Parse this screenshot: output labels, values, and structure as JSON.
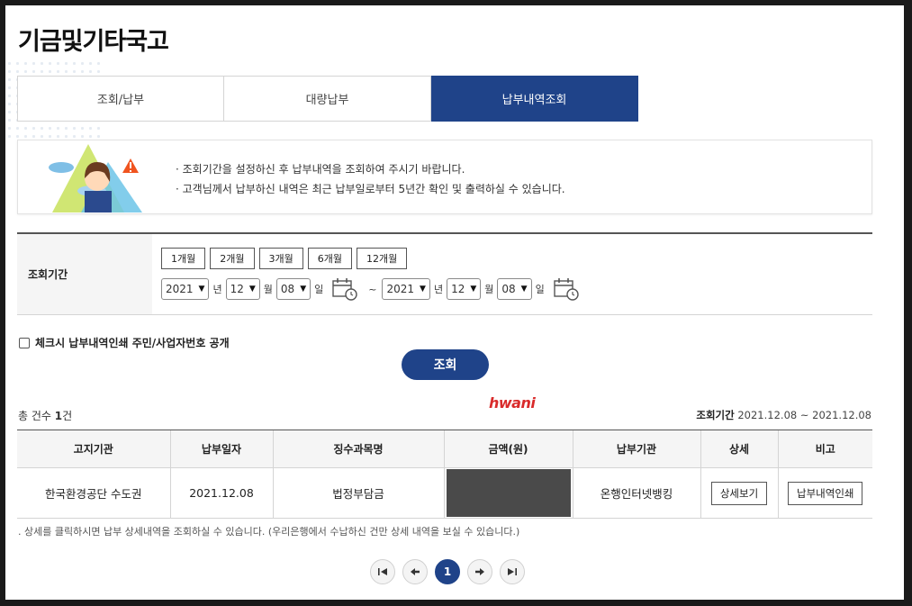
{
  "page": {
    "title": "기금및기타국고"
  },
  "tabs": [
    {
      "label": "조회/납부",
      "active": false
    },
    {
      "label": "대량납부",
      "active": false
    },
    {
      "label": "납부내역조회",
      "active": true
    }
  ],
  "notice": {
    "lines": [
      "조회기간을 설정하신 후 납부내역을 조회하여 주시기 바랍니다.",
      "고객님께서 납부하신 내역은 최근 납부일로부터 5년간 확인 및 출력하실 수 있습니다."
    ]
  },
  "search": {
    "label": "조회기간",
    "months": [
      "1개월",
      "2개월",
      "3개월",
      "6개월",
      "12개월"
    ],
    "from": {
      "year": "2021",
      "month": "12",
      "day": "08"
    },
    "to": {
      "year": "2021",
      "month": "12",
      "day": "08"
    },
    "unit_year": "년",
    "unit_month": "월",
    "unit_day": "일",
    "tilde": "~"
  },
  "consent": {
    "label": "체크시 납부내역인쇄 주민/사업자번호 공개",
    "checked": false
  },
  "query_button": "조회",
  "watermark": "hwani",
  "summary": {
    "total_prefix": "총 건수",
    "total_count": "1",
    "total_suffix": "건",
    "period_label": "조회기간",
    "period_value": "2021.12.08 ~ 2021.12.08"
  },
  "table": {
    "headers": [
      "고지기관",
      "납부일자",
      "징수과목명",
      "금액(원)",
      "납부기관",
      "상세",
      "비고"
    ],
    "rows": [
      {
        "agency": "한국환경공단 수도권",
        "date": "2021.12.08",
        "subject": "법정부담금",
        "amount": "",
        "payer": "온행인터넷뱅킹",
        "detail_button": "상세보기",
        "print_button": "납부내역인쇄"
      }
    ]
  },
  "footnote": ". 상세를 클릭하시면 납부 상세내역을 조회하실 수 있습니다. (우리은행에서 수납하신 건만 상세 내역을 보실 수 있습니다.)",
  "pagination": {
    "current": "1"
  },
  "colors": {
    "primary": "#1f4389",
    "watermark": "#d92b2b",
    "mask": "#4a4a4a"
  }
}
